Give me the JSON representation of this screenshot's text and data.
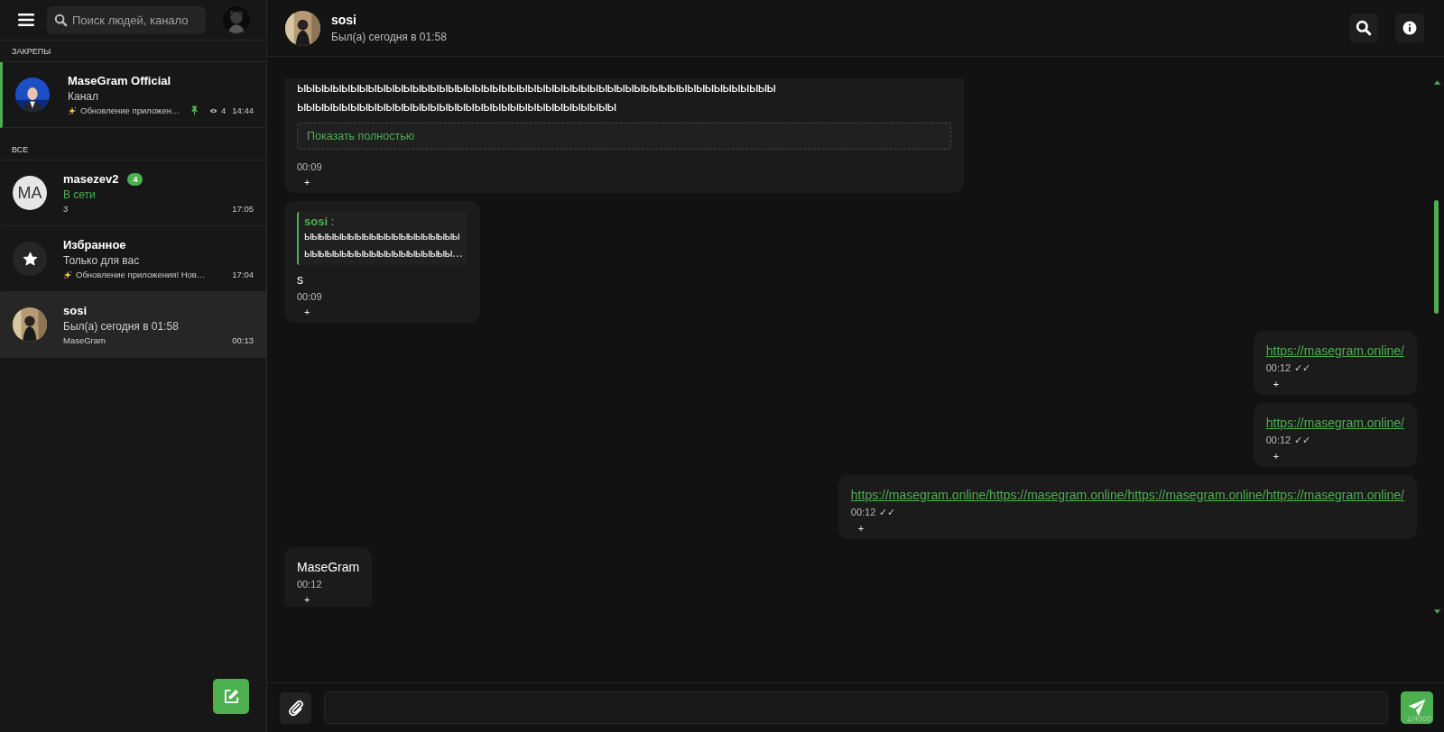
{
  "sidebar": {
    "search": {
      "placeholder": "Поиск людей, канало"
    },
    "sections": [
      {
        "title": "ЗАКРЕПЫ",
        "chats": [
          {
            "name": "MaseGram Official",
            "status": "Канал",
            "online": false,
            "sparkle": true,
            "preview": "Обновление приложен…",
            "pinned": true,
            "views": "4",
            "time": "14:44",
            "selected": false
          }
        ]
      },
      {
        "title": "ВСЕ",
        "chats": [
          {
            "name": "masezev2",
            "avatar": {
              "kind": "initials",
              "text": "MA"
            },
            "badge": "4",
            "status": "В сети",
            "online": true,
            "preview": "3",
            "pinned": false,
            "time": "17:05",
            "selected": false
          },
          {
            "name": "Избранное",
            "avatar": {
              "kind": "star"
            },
            "status": "Только для вас",
            "online": false,
            "sparkle": true,
            "preview": "Обновление приложения! Нов…",
            "pinned": false,
            "time": "17:04",
            "selected": false
          },
          {
            "name": "sosi",
            "status": "Был(а) сегодня в 01:58",
            "online": false,
            "preview": "MaseGram",
            "pinned": false,
            "time": "00:13",
            "selected": true
          }
        ]
      }
    ]
  },
  "chat_header": {
    "name": "sosi",
    "status": "Был(а) сегодня в 01:58"
  },
  "messages": [
    {
      "kind": "incoming",
      "cut_top": true,
      "lines": [
        "ыыыыыыыыыыыыыыыыыыыыыыыыыыыыыыыыыыыыыыыыыыыыыыыыыыыыыы",
        "ыыыыыыыыыыыыыыыыыыыыыыыыыыыыыыыыыыыы"
      ],
      "show_more": "Показать полностью",
      "time": "00:09",
      "reaction": "+"
    },
    {
      "kind": "incoming",
      "reply": {
        "author": "sosi",
        "separator": ":",
        "lines": [
          "ыыыыыыыыыыыыыыыыыыыыы",
          "ыыыыыыыыыыыыыыыыыыыы…"
        ]
      },
      "text": "s",
      "time": "00:09",
      "reaction": "+"
    },
    {
      "kind": "outgoing",
      "link": "https://masegram.online/",
      "time": "00:12",
      "ticks": "✓✓",
      "reaction": "+"
    },
    {
      "kind": "outgoing",
      "link": "https://masegram.online/",
      "time": "00:12",
      "ticks": "✓✓",
      "reaction": "+"
    },
    {
      "kind": "outgoing",
      "link": "https://masegram.online/https://masegram.online/https://masegram.online/https://masegram.online/",
      "time": "00:12",
      "ticks": "✓✓",
      "reaction": "+"
    },
    {
      "kind": "incoming",
      "cut_bottom": true,
      "text": "MaseGram",
      "time": "00:12",
      "reaction": "+"
    }
  ],
  "composer": {
    "counter": "1/4000"
  }
}
